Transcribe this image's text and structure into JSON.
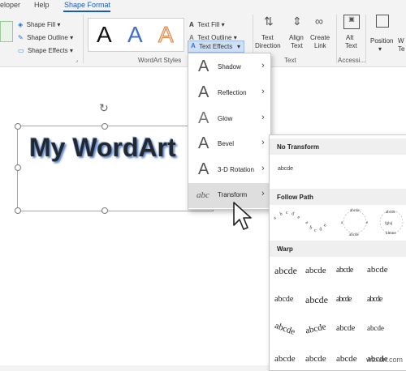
{
  "tabs": [
    "eloper",
    "Help",
    "Shape Format"
  ],
  "ribbon": {
    "shape_fill": "Shape Fill",
    "shape_outline": "Shape Outline",
    "shape_effects": "Shape Effects",
    "gallery": [
      "A",
      "A",
      "A"
    ],
    "wordart_styles_label": "WordArt Styles",
    "text_fill": "Text Fill",
    "text_outline": "Text Outline",
    "text_effects": "Text Effects",
    "text_direction": [
      "Text",
      "Direction"
    ],
    "align_text": [
      "Align",
      "Text"
    ],
    "create_link": [
      "Create",
      "Link"
    ],
    "text_group_label": "Text",
    "alt_text": [
      "Alt",
      "Text"
    ],
    "accessibility_label": "Accessi...",
    "position": "Position",
    "wrap_text": [
      "W",
      "Te"
    ]
  },
  "document": {
    "wordart_text": "My WordArt"
  },
  "text_effects_menu": [
    {
      "label": "Shadow"
    },
    {
      "label": "Reflection"
    },
    {
      "label": "Glow"
    },
    {
      "label": "Bevel"
    },
    {
      "label": "3-D Rotation"
    },
    {
      "label": "Transform",
      "icon_text": "abc"
    }
  ],
  "transform_menu": {
    "no_transform_header": "No Transform",
    "no_transform_sample": "abcde",
    "follow_path_header": "Follow Path",
    "warp_header": "Warp",
    "sample": "abcde"
  },
  "watermark": "wsxdn.com",
  "colors": {
    "accent": "#185abd",
    "wordart_shadow": "#5b86c8"
  }
}
